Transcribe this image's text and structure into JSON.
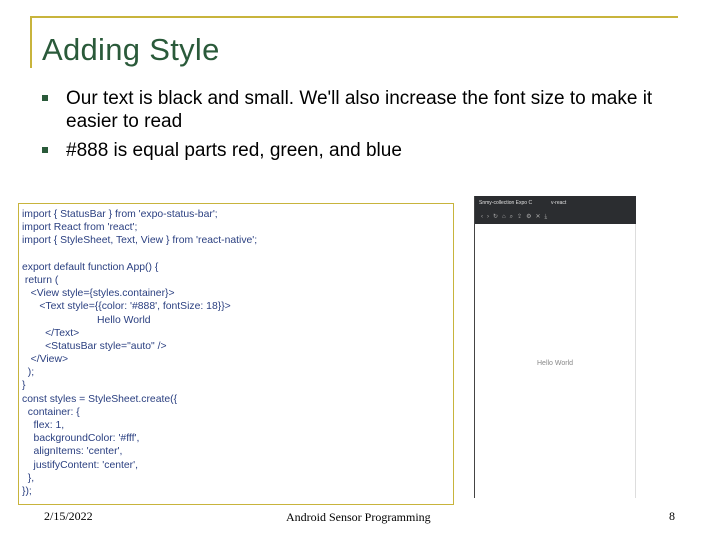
{
  "slide": {
    "title": "Adding Style",
    "bullets": [
      "Our text is black and small. We'll also increase the font size to make it easier to read",
      "#888 is equal parts red, green, and blue"
    ],
    "accent_color": "#c8b43c",
    "title_color": "#2a5a3a"
  },
  "code": {
    "lines": [
      "import { StatusBar } from 'expo-status-bar';",
      "import React from 'react';",
      "import { StyleSheet, Text, View } from 'react-native';",
      "",
      "export default function App() {",
      " return (",
      "   <View style={styles.container}>",
      "      <Text style={{color: '#888', fontSize: 18}}>",
      "                          Hello World",
      "        </Text>",
      "        <StatusBar style=\"auto\" />",
      "   </View>",
      "  );",
      "}",
      "const styles = StyleSheet.create({",
      "  container: {",
      "    flex: 1,",
      "    backgroundColor: '#fff',",
      "    alignItems: 'center',",
      "    justifyContent: 'center',",
      "  },",
      "});"
    ]
  },
  "preview": {
    "tab_label": "Snmy-collection Expo C",
    "tab2_label": "v-react",
    "hello_text": "Hello World"
  },
  "footer": {
    "date": "2/15/2022",
    "title": "Android Sensor Programming",
    "page": "8"
  }
}
